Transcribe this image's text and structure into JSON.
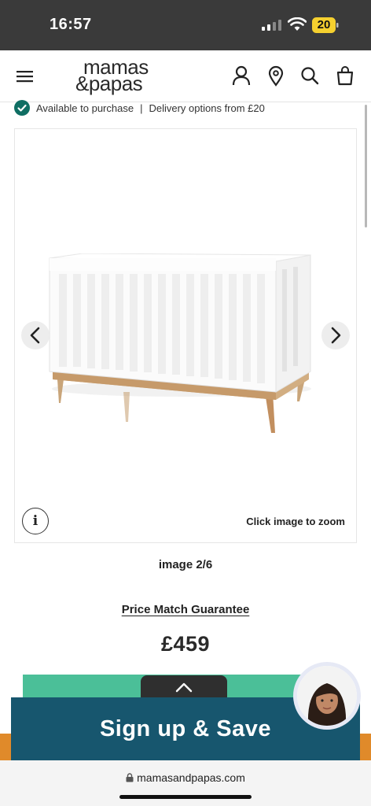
{
  "status_bar": {
    "time": "16:57",
    "battery_level": "20",
    "battery_color": "#f5d02f"
  },
  "header": {
    "logo_line1": "mamas",
    "logo_line2": "&papas",
    "icons": [
      "menu-icon",
      "account-icon",
      "store-locator-icon",
      "search-icon",
      "basket-icon"
    ]
  },
  "availability": {
    "status": "Available to purchase",
    "separator": "|",
    "delivery": "Delivery options from £20",
    "check_color": "#0f6e63"
  },
  "gallery": {
    "zoom_hint": "Click image to zoom",
    "info_symbol": "i",
    "counter": "image 2/6",
    "image_alt": "white cot with wooden legs"
  },
  "product": {
    "price_match": "Price Match Guarantee",
    "price": "£459"
  },
  "promo": {
    "signup_label": "Sign up & Save",
    "banner_color": "#17566e",
    "button_color": "#4bbf98",
    "strip_color": "#e08a2a"
  },
  "browser": {
    "url": "mamasandpapas.com"
  }
}
